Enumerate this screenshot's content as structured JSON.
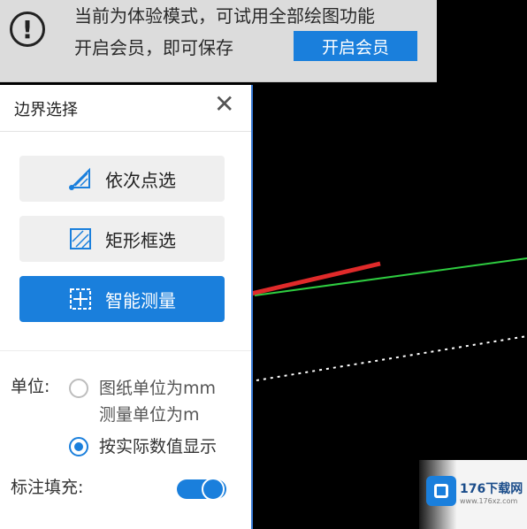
{
  "banner": {
    "line1": "当前为体验模式，可试用全部绘图功能",
    "line2": "开启会员，即可保存",
    "vip_button": "开启会员"
  },
  "panel": {
    "title": "边界选择",
    "buttons": {
      "point_select": "依次点选",
      "rect_select": "矩形框选",
      "smart_measure": "智能测量"
    },
    "unit_label": "单位:",
    "unit_options": {
      "option1_line1": "图纸单位为mm",
      "option1_line2": "测量单位为m",
      "option2": "按实际数值显示"
    },
    "selected_unit_option": 2,
    "fill_label": "标注填充:",
    "fill_enabled": true
  },
  "watermark": {
    "title": "176下载网",
    "sub": "www.176xz.com"
  },
  "colors": {
    "accent": "#1a7fdc",
    "cad_line": "#2ecc40",
    "arrow": "#e02a2a"
  }
}
